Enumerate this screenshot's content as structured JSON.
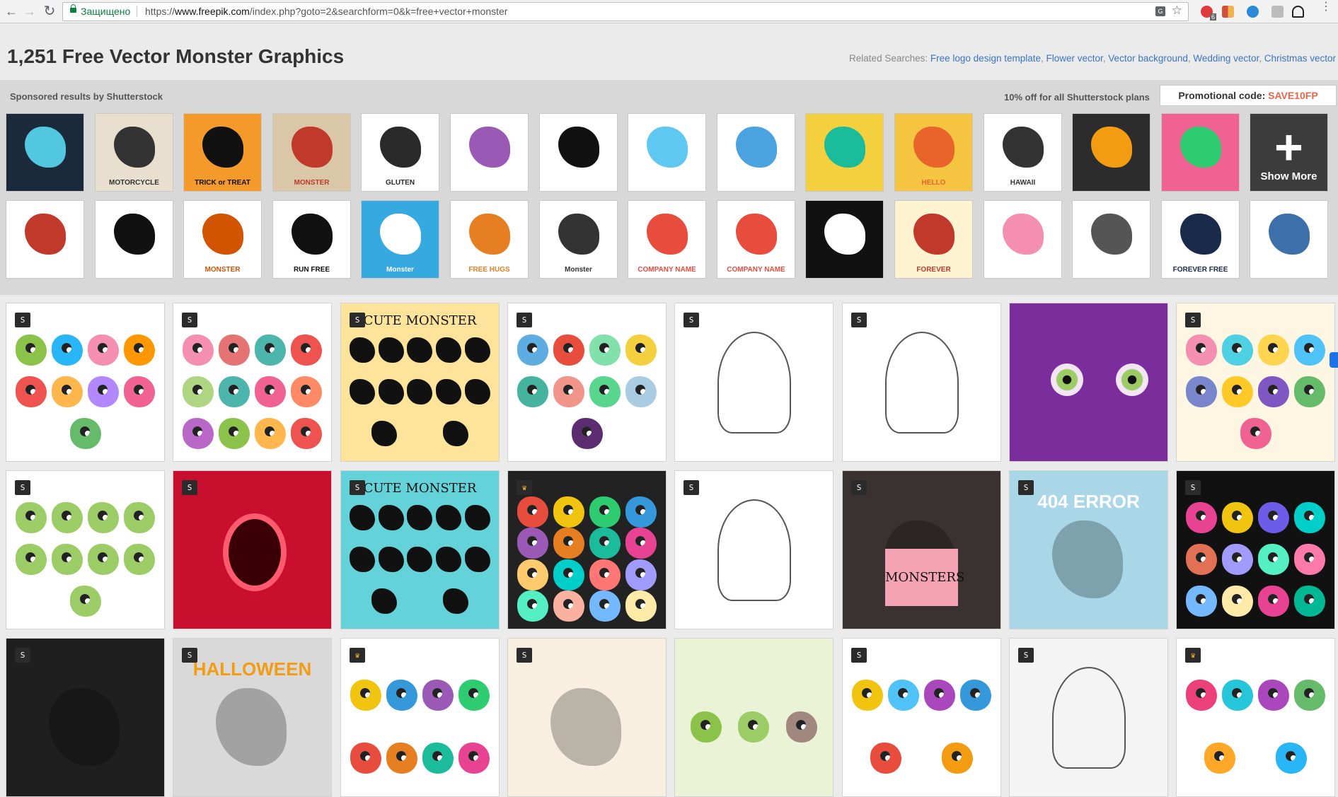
{
  "browser": {
    "secure_label": "Защищено",
    "url_prefix": "https://",
    "url_host": "www.freepik.com",
    "url_path": "/index.php?goto=2&searchform=0&k=free+vector+monster",
    "adblock_count": "6"
  },
  "header": {
    "title": "1,251 Free Vector Monster Graphics",
    "related_label": "Related Searches:",
    "related_links": [
      "Free logo design template",
      "Flower vector",
      "Vector background",
      "Wedding vector",
      "Christmas vector"
    ]
  },
  "sponsored": {
    "label": "Sponsored results by Shutterstock",
    "offer": "10% off for all Shutterstock plans",
    "promo_label": "Promotional code:",
    "promo_code": "SAVE10FP",
    "show_more": "Show More",
    "row1": [
      {
        "bg": "#1a2a3a",
        "fg": "#52c7e0",
        "text": ""
      },
      {
        "bg": "#e8dfcf",
        "fg": "#333",
        "text": "MOTORCYCLE"
      },
      {
        "bg": "#f39a2a",
        "fg": "#111",
        "text": "TRICK or TREAT"
      },
      {
        "bg": "#d9c7a8",
        "fg": "#c0392b",
        "text": "MONSTER"
      },
      {
        "bg": "#ffffff",
        "fg": "#2a2a2a",
        "text": "GLUTEN"
      },
      {
        "bg": "#ffffff",
        "fg": "#9b59b6",
        "text": ""
      },
      {
        "bg": "#ffffff",
        "fg": "#111",
        "text": ""
      },
      {
        "bg": "#ffffff",
        "fg": "#5fc8f0",
        "text": ""
      },
      {
        "bg": "#ffffff",
        "fg": "#4aa3df",
        "text": ""
      },
      {
        "bg": "#f4d03f",
        "fg": "#1abc9c",
        "text": ""
      },
      {
        "bg": "#f5c542",
        "fg": "#e8642a",
        "text": "HELLO"
      },
      {
        "bg": "#ffffff",
        "fg": "#333",
        "text": "HAWAII"
      },
      {
        "bg": "#2c2c2c",
        "fg": "#f39c12",
        "text": ""
      },
      {
        "bg": "#f06292",
        "fg": "#2ecc71",
        "text": ""
      }
    ],
    "row2": [
      {
        "bg": "#ffffff",
        "fg": "#c0392b",
        "text": ""
      },
      {
        "bg": "#ffffff",
        "fg": "#111",
        "text": ""
      },
      {
        "bg": "#ffffff",
        "fg": "#d35400",
        "text": "MONSTER"
      },
      {
        "bg": "#ffffff",
        "fg": "#111",
        "text": "RUN FREE"
      },
      {
        "bg": "#35a9e0",
        "fg": "#ffffff",
        "text": "Monster"
      },
      {
        "bg": "#ffffff",
        "fg": "#e67e22",
        "text": "FREE HUGS"
      },
      {
        "bg": "#ffffff",
        "fg": "#333",
        "text": "Monster"
      },
      {
        "bg": "#ffffff",
        "fg": "#e74c3c",
        "text": "COMPANY NAME"
      },
      {
        "bg": "#ffffff",
        "fg": "#e74c3c",
        "text": "COMPANY NAME"
      },
      {
        "bg": "#111111",
        "fg": "#ffffff",
        "text": ""
      },
      {
        "bg": "#fdf3d0",
        "fg": "#c0392b",
        "text": "FOREVER"
      },
      {
        "bg": "#ffffff",
        "fg": "#f48fb1",
        "text": ""
      },
      {
        "bg": "#ffffff",
        "fg": "#555",
        "text": ""
      },
      {
        "bg": "#ffffff",
        "fg": "#1a2a4a",
        "text": "FOREVER FREE"
      },
      {
        "bg": "#ffffff",
        "fg": "#3d6fa8",
        "text": ""
      }
    ]
  },
  "results": [
    {
      "bg": "#ffffff",
      "title": "",
      "title_color": "",
      "blob_colors": [
        "#8bc34a",
        "#29b6f6",
        "#f48fb1",
        "#ff9800",
        "#ef5350",
        "#ffb74d",
        "#b388ff",
        "#f06292",
        "#66bb6a"
      ],
      "badge": "S",
      "crown": false
    },
    {
      "bg": "#ffffff",
      "title": "",
      "title_color": "",
      "blob_colors": [
        "#f48fb1",
        "#e57373",
        "#4db6ac",
        "#ef5350",
        "#aed581",
        "#4db6ac",
        "#f06292",
        "#ff8a65",
        "#ba68c8",
        "#8bc34a",
        "#ffb74d",
        "#ef5350"
      ],
      "badge": "S",
      "crown": false
    },
    {
      "bg": "#fde49a",
      "title": "CUTE MONSTER",
      "title_color": "#111",
      "blob_colors": [],
      "badge": "S",
      "crown": false
    },
    {
      "bg": "#ffffff",
      "title": "",
      "title_color": "",
      "blob_colors": [
        "#5dade2",
        "#e74c3c",
        "#82e0aa",
        "#f4d03f",
        "#45b39d",
        "#f1948a",
        "#58d68d",
        "#a9cce3",
        "#5b2c6f"
      ],
      "badge": "S",
      "crown": false
    },
    {
      "bg": "#ffffff",
      "title": "",
      "title_color": "",
      "blob_colors": [],
      "badge": "S",
      "crown": false
    },
    {
      "bg": "#ffffff",
      "title": "",
      "title_color": "",
      "blob_colors": [],
      "badge": "S",
      "crown": false
    },
    {
      "bg": "#7b2d9c",
      "title": "",
      "title_color": "",
      "blob_colors": [],
      "badge": "",
      "crown": false
    },
    {
      "bg": "#fdf6e3",
      "title": "",
      "title_color": "",
      "blob_colors": [
        "#f48fb1",
        "#4dd0e1",
        "#ffd54f",
        "#4fc3f7",
        "#7986cb",
        "#ffca28",
        "#7e57c2",
        "#66bb6a",
        "#f06292"
      ],
      "badge": "S",
      "crown": false
    },
    {
      "bg": "#ffffff",
      "title": "",
      "title_color": "",
      "blob_colors": [
        "#9ccc65",
        "#9ccc65",
        "#9ccc65",
        "#9ccc65",
        "#9ccc65",
        "#9ccc65",
        "#9ccc65",
        "#9ccc65",
        "#9ccc65"
      ],
      "badge": "S",
      "crown": false
    },
    {
      "bg": "#c8102e",
      "title": "",
      "title_color": "",
      "blob_colors": [],
      "badge": "S",
      "crown": false
    },
    {
      "bg": "#63d3d9",
      "title": "CUTE MONSTER",
      "title_color": "#111",
      "blob_colors": [],
      "badge": "S",
      "crown": false
    },
    {
      "bg": "#222222",
      "title": "",
      "title_color": "",
      "blob_colors": [
        "#e74c3c",
        "#f1c40f",
        "#2ecc71",
        "#3498db",
        "#9b59b6",
        "#e67e22",
        "#1abc9c",
        "#e84393",
        "#fdcb6e",
        "#00cec9",
        "#ff7675",
        "#a29bfe",
        "#55efc4",
        "#fab1a0",
        "#74b9ff",
        "#ffeaa7"
      ],
      "badge": "",
      "crown": true
    },
    {
      "bg": "#ffffff",
      "title": "",
      "title_color": "",
      "blob_colors": [],
      "badge": "S",
      "crown": false
    },
    {
      "bg": "#3a3230",
      "title": "MONSTERS",
      "title_color": "#111",
      "blob_colors": [],
      "badge": "S",
      "crown": false
    },
    {
      "bg": "#a9d7e8",
      "title": "404 ERROR",
      "title_color": "#ffffff",
      "blob_colors": [],
      "badge": "S",
      "crown": false
    },
    {
      "bg": "#111111",
      "title": "",
      "title_color": "",
      "blob_colors": [
        "#e84393",
        "#f1c40f",
        "#6c5ce7",
        "#00cec9",
        "#e17055",
        "#a29bfe",
        "#55efc4",
        "#fd79a8",
        "#74b9ff",
        "#ffeaa7",
        "#e84393",
        "#00b894"
      ],
      "badge": "S",
      "crown": false
    },
    {
      "bg": "#1f1f1f",
      "title": "",
      "title_color": "",
      "blob_colors": [],
      "badge": "S",
      "crown": false
    },
    {
      "bg": "#d9d9d9",
      "title": "HALLOWEEN",
      "title_color": "#f39c12",
      "blob_colors": [],
      "badge": "S",
      "crown": false
    },
    {
      "bg": "#ffffff",
      "title": "",
      "title_color": "",
      "blob_colors": [
        "#f1c40f",
        "#3498db",
        "#9b59b6",
        "#2ecc71",
        "#e74c3c",
        "#e67e22",
        "#1abc9c",
        "#e84393"
      ],
      "badge": "",
      "crown": true
    },
    {
      "bg": "#f8efe0",
      "title": "",
      "title_color": "",
      "blob_colors": [],
      "badge": "S",
      "crown": false
    },
    {
      "bg": "#eaf3d6",
      "title": "",
      "title_color": "",
      "blob_colors": [
        "#8bc34a",
        "#9ccc65",
        "#a1887f"
      ],
      "badge": "",
      "crown": false
    },
    {
      "bg": "#ffffff",
      "title": "",
      "title_color": "",
      "blob_colors": [
        "#f1c40f",
        "#4fc3f7",
        "#ab47bc",
        "#3498db",
        "#e74c3c",
        "#f39c12"
      ],
      "badge": "S",
      "crown": false
    },
    {
      "bg": "#f4f4f4",
      "title": "",
      "title_color": "",
      "blob_colors": [],
      "badge": "S",
      "crown": false
    },
    {
      "bg": "#ffffff",
      "title": "",
      "title_color": "",
      "blob_colors": [
        "#ec407a",
        "#26c6da",
        "#ab47bc",
        "#66bb6a",
        "#ffa726",
        "#29b6f6"
      ],
      "badge": "",
      "crown": true
    }
  ]
}
